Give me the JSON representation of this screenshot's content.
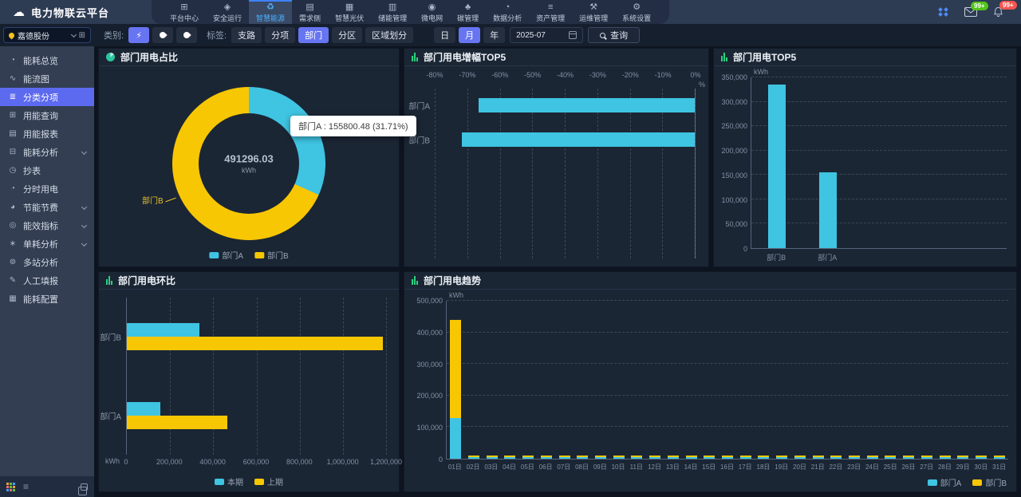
{
  "app": {
    "title": "电力物联云平台"
  },
  "topnav": {
    "items": [
      {
        "id": "platform-center",
        "label": "平台中心"
      },
      {
        "id": "safe-operation",
        "label": "安全运行"
      },
      {
        "id": "smart-energy",
        "label": "智慧能源",
        "active": true
      },
      {
        "id": "demand-side",
        "label": "需求侧"
      },
      {
        "id": "smart-pv",
        "label": "智慧光伏"
      },
      {
        "id": "storage-mgmt",
        "label": "储能管理"
      },
      {
        "id": "microgrid",
        "label": "微电网"
      },
      {
        "id": "carbon-mgmt",
        "label": "碳管理"
      },
      {
        "id": "data-analysis",
        "label": "数据分析"
      },
      {
        "id": "asset-mgmt",
        "label": "资产管理"
      },
      {
        "id": "ops-mgmt",
        "label": "运维管理"
      },
      {
        "id": "system-settings",
        "label": "系统设置"
      }
    ],
    "badges": {
      "mail": "99+",
      "alert": "99+"
    }
  },
  "org_selector": {
    "value": "嘉德股份"
  },
  "filters": {
    "category_label": "类别:",
    "categories": [
      {
        "id": "electric",
        "icon": "lightning-icon",
        "active": true
      },
      {
        "id": "water",
        "icon": "water-drop-icon",
        "active": false
      },
      {
        "id": "fire",
        "icon": "flame-icon",
        "active": false
      }
    ],
    "tag_label": "标签:",
    "tags": [
      {
        "label": "支路",
        "active": false
      },
      {
        "label": "分项",
        "active": false
      },
      {
        "label": "部门",
        "active": true
      },
      {
        "label": "分区",
        "active": false
      },
      {
        "label": "区域划分",
        "active": false
      }
    ],
    "period": [
      {
        "label": "日",
        "active": false
      },
      {
        "label": "月",
        "active": true
      },
      {
        "label": "年",
        "active": false
      }
    ],
    "date": "2025-07",
    "search_label": "查询"
  },
  "sidebar": {
    "items": [
      {
        "id": "energy-overview",
        "label": "能耗总览"
      },
      {
        "id": "energy-flow",
        "label": "能流图"
      },
      {
        "id": "category-breakdown",
        "label": "分类分项",
        "active": true
      },
      {
        "id": "energy-query",
        "label": "用能查询"
      },
      {
        "id": "energy-report",
        "label": "用能报表"
      },
      {
        "id": "energy-analysis",
        "label": "能耗分析",
        "expandable": true
      },
      {
        "id": "meter-reading",
        "label": "抄表"
      },
      {
        "id": "tou-power",
        "label": "分时用电"
      },
      {
        "id": "energy-saving",
        "label": "节能节费",
        "expandable": true
      },
      {
        "id": "efficiency-index",
        "label": "能效指标",
        "expandable": true
      },
      {
        "id": "unit-consumption",
        "label": "单耗分析",
        "expandable": true
      },
      {
        "id": "multi-station",
        "label": "多站分析"
      },
      {
        "id": "manual-report",
        "label": "人工填报"
      },
      {
        "id": "energy-config",
        "label": "能耗配置"
      }
    ]
  },
  "colors": {
    "cyan": "#3fc4e2",
    "yellow": "#f8c703"
  },
  "chart_data": [
    {
      "type": "pie",
      "title": "部门用电占比",
      "icon": "pie-chart-icon",
      "center_value": "491296.03",
      "center_unit": "kWh",
      "slices": [
        {
          "name": "部门A",
          "value": 155800.48,
          "pct": 31.71,
          "color": "#3fc4e2"
        },
        {
          "name": "部门B",
          "value": 335495.55,
          "pct": 68.29,
          "color": "#f8c703"
        }
      ],
      "tooltip": "部门A : 155800.48 (31.71%)",
      "callout": "部门B",
      "legend": [
        "部门A",
        "部门B"
      ]
    },
    {
      "type": "bar",
      "title": "部门用电增幅TOP5",
      "icon": "bar-chart-icon",
      "orientation": "horizontal",
      "unit": "%",
      "categories": [
        "部门A",
        "部门B"
      ],
      "values": [
        -66.49,
        -71.69
      ],
      "slots": 5,
      "xticks": [
        "-80%",
        "-70%",
        "-60%",
        "-50%",
        "-40%",
        "-30%",
        "-20%",
        "-10%",
        "0%"
      ],
      "xlim": [
        -80,
        0
      ],
      "color": "#3fc4e2"
    },
    {
      "type": "bar",
      "title": "部门用电TOP5",
      "icon": "bar-chart-icon",
      "unit": "kWh",
      "categories": [
        "部门B",
        "部门A"
      ],
      "values": [
        335495.55,
        155800.48
      ],
      "slots": 5,
      "yticks": [
        "0",
        "50,000",
        "100,000",
        "150,000",
        "200,000",
        "250,000",
        "300,000",
        "350,000"
      ],
      "ylim": [
        0,
        350000
      ],
      "color": "#3fc4e2"
    },
    {
      "type": "bar",
      "title": "部门用电环比",
      "icon": "bar-chart-icon",
      "orientation": "horizontal",
      "unit": "kWh",
      "categories": [
        "部门B",
        "部门A"
      ],
      "series": [
        {
          "name": "本期",
          "color": "#3fc4e2",
          "values": [
            335495.55,
            155800.48
          ]
        },
        {
          "name": "上期",
          "color": "#f8c703",
          "values": [
            1185000,
            465000
          ]
        }
      ],
      "xticks": [
        "0",
        "200,000",
        "400,000",
        "600,000",
        "800,000",
        "1,000,000",
        "1,200,000"
      ],
      "xlim": [
        0,
        1200000
      ],
      "legend": [
        "本期",
        "上期"
      ]
    },
    {
      "type": "bar",
      "stacked": true,
      "title": "部门用电趋势",
      "icon": "bar-chart-icon",
      "unit": "kWh",
      "categories": [
        "01日",
        "02日",
        "03日",
        "04日",
        "05日",
        "06日",
        "07日",
        "08日",
        "09日",
        "10日",
        "11日",
        "12日",
        "13日",
        "14日",
        "15日",
        "16日",
        "17日",
        "18日",
        "19日",
        "20日",
        "21日",
        "22日",
        "23日",
        "24日",
        "25日",
        "26日",
        "27日",
        "28日",
        "29日",
        "30日",
        "31日"
      ],
      "series": [
        {
          "name": "部门A",
          "color": "#3fc4e2",
          "values": [
            130000,
            4000,
            4000,
            4000,
            4000,
            4000,
            4000,
            4000,
            4000,
            4000,
            4000,
            4000,
            4000,
            4000,
            4000,
            4000,
            4000,
            4000,
            4000,
            4000,
            4000,
            4000,
            4000,
            4000,
            4000,
            4000,
            4000,
            4000,
            4000,
            4000,
            4000
          ]
        },
        {
          "name": "部门B",
          "color": "#f8c703",
          "values": [
            310000,
            5000,
            5000,
            5000,
            5000,
            5000,
            5000,
            5000,
            5000,
            5000,
            5000,
            5000,
            5000,
            5000,
            5000,
            5000,
            5000,
            5000,
            5000,
            5000,
            5000,
            5000,
            5000,
            5000,
            5000,
            5000,
            5000,
            5000,
            5000,
            5000,
            5000
          ]
        }
      ],
      "yticks": [
        "0",
        "100,000",
        "200,000",
        "300,000",
        "400,000",
        "500,000"
      ],
      "ylim": [
        0,
        500000
      ],
      "legend": [
        "部门A",
        "部门B"
      ]
    }
  ]
}
